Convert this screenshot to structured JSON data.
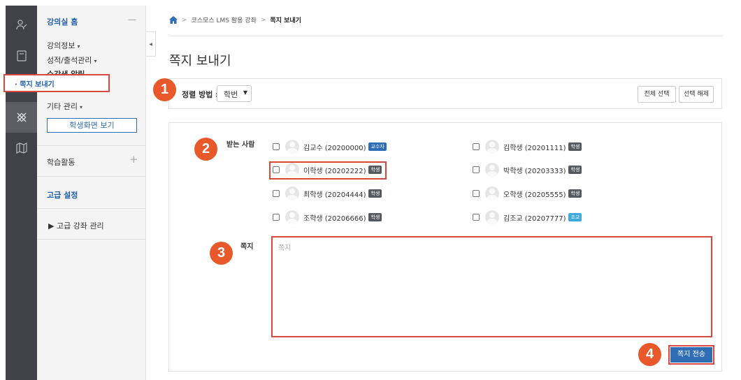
{
  "nav": {
    "home": "강의실 홈",
    "collapse_symbol": "—",
    "course_info": "강의정보",
    "grades": "성적/출석관리",
    "notice": "수강생 알림",
    "send_message": "· 쪽지 보내기",
    "other": "기타 관리",
    "student_view": "학생화면 보기",
    "activities": "학습활동",
    "add_symbol": "+",
    "advanced": "고급 설정",
    "advanced_course": "▶ 고급 강좌 관리",
    "caret": "▾",
    "caret_up": "▴"
  },
  "breadcrumb": {
    "course": "코스모스 LMS 활용 강좌",
    "current": "쪽지 보내기",
    "separator": ">"
  },
  "page_title": "쪽지 보내기",
  "sort": {
    "label": "정렬 방법 :",
    "value": "학번",
    "select_all": "전체 선택",
    "deselect": "선택 해제"
  },
  "form": {
    "recipients_label": "받는 사람",
    "message_label": "쪽지",
    "message_placeholder": "쪽지",
    "send_button": "쪽지 전송"
  },
  "recipients": [
    {
      "name": "김교수 (20200000)",
      "role": "교수자",
      "role_color": "#2f6db5"
    },
    {
      "name": "김학생 (20201111)",
      "role": "학생",
      "role_color": "#555a60"
    },
    {
      "name": "이학생 (20202222)",
      "role": "학생",
      "role_color": "#555a60"
    },
    {
      "name": "박학생 (20203333)",
      "role": "학생",
      "role_color": "#555a60"
    },
    {
      "name": "최학생 (20204444)",
      "role": "학생",
      "role_color": "#555a60"
    },
    {
      "name": "오학생 (20205555)",
      "role": "학생",
      "role_color": "#555a60"
    },
    {
      "name": "조학생 (20206666)",
      "role": "학생",
      "role_color": "#555a60"
    },
    {
      "name": "김조교 (20207777)",
      "role": "조교",
      "role_color": "#3fa9e0"
    }
  ],
  "steps": [
    "1",
    "2",
    "3",
    "4"
  ],
  "colors": {
    "accent": "#2f6db5",
    "highlight": "#d9473f",
    "step_marker": "#e8582a",
    "rail": "#3f4249"
  }
}
